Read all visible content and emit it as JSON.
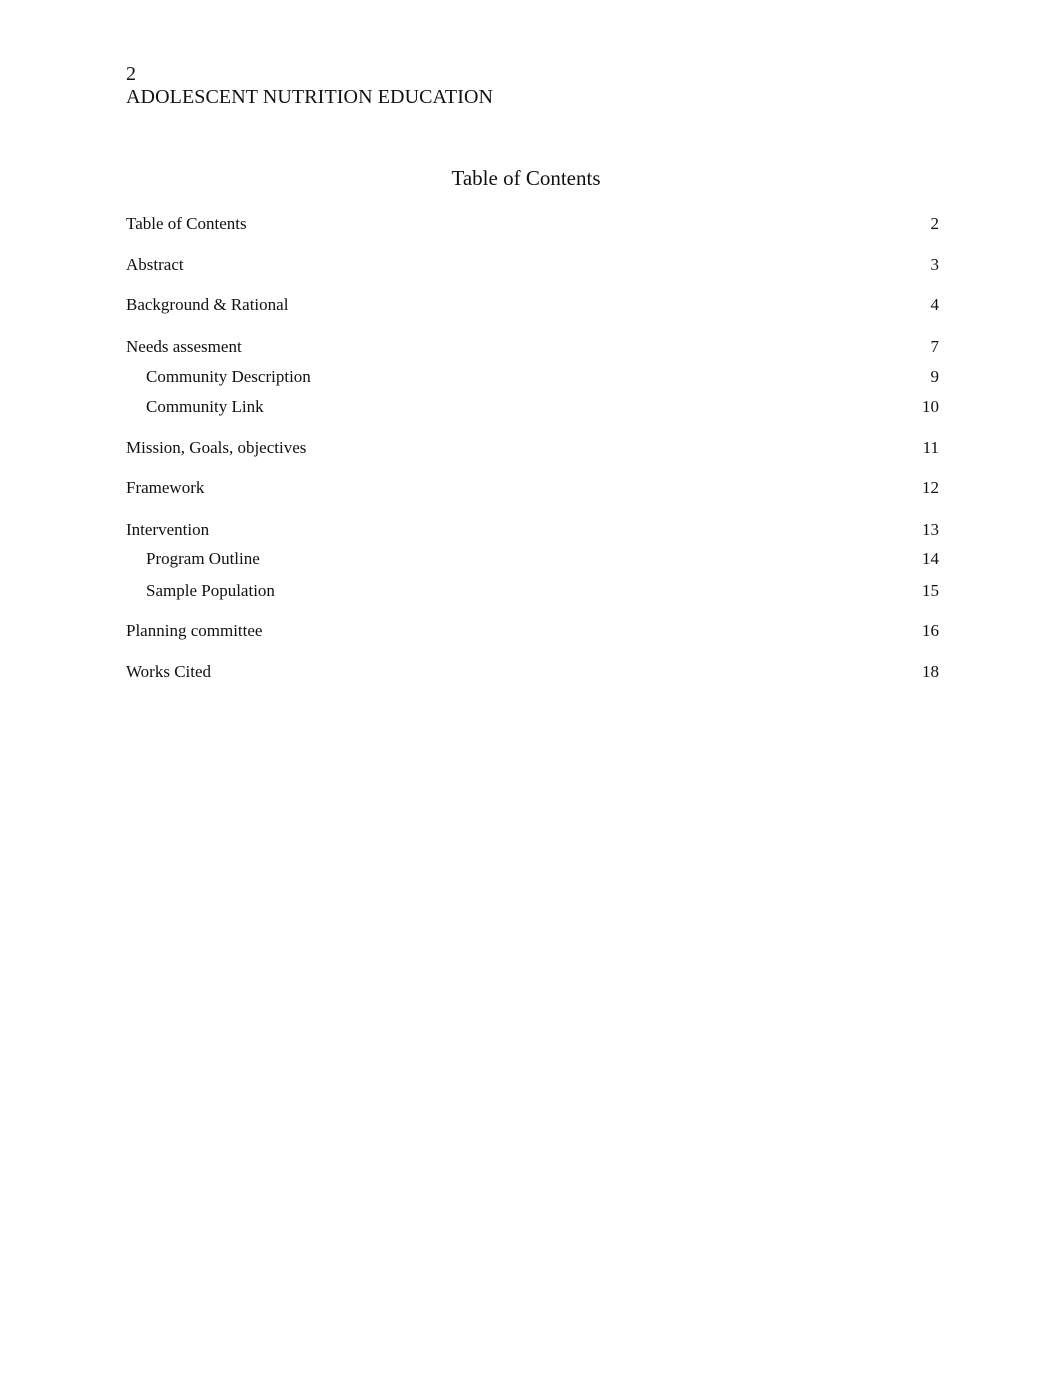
{
  "header": {
    "page_number": "2",
    "running_head": "ADOLESCENT NUTRITION EDUCATION"
  },
  "toc": {
    "title": "Table of Contents",
    "entries": [
      {
        "label": "Table of Contents",
        "page": "2",
        "level": 1
      },
      {
        "label": "Abstract",
        "page": "3",
        "level": 1
      },
      {
        "label": "Background & Rational",
        "page": "4",
        "level": 1
      },
      {
        "label": "Needs assesment",
        "page": "7",
        "level": 1
      },
      {
        "label": "Community Description",
        "page": "9",
        "level": 2
      },
      {
        "label": "Community Link",
        "page": "10",
        "level": 2
      },
      {
        "label": "Mission, Goals, objectives",
        "page": "11",
        "level": 1
      },
      {
        "label": "Framework",
        "page": "12",
        "level": 1
      },
      {
        "label": "Intervention",
        "page": "13",
        "level": 1
      },
      {
        "label": "Program Outline",
        "page": "14",
        "level": 2
      },
      {
        "label": "Sample Population",
        "page": "15",
        "level": 2
      },
      {
        "label": "Planning committee",
        "page": "16",
        "level": 1
      },
      {
        "label": "Works Cited",
        "page": "18",
        "level": 1
      }
    ]
  }
}
